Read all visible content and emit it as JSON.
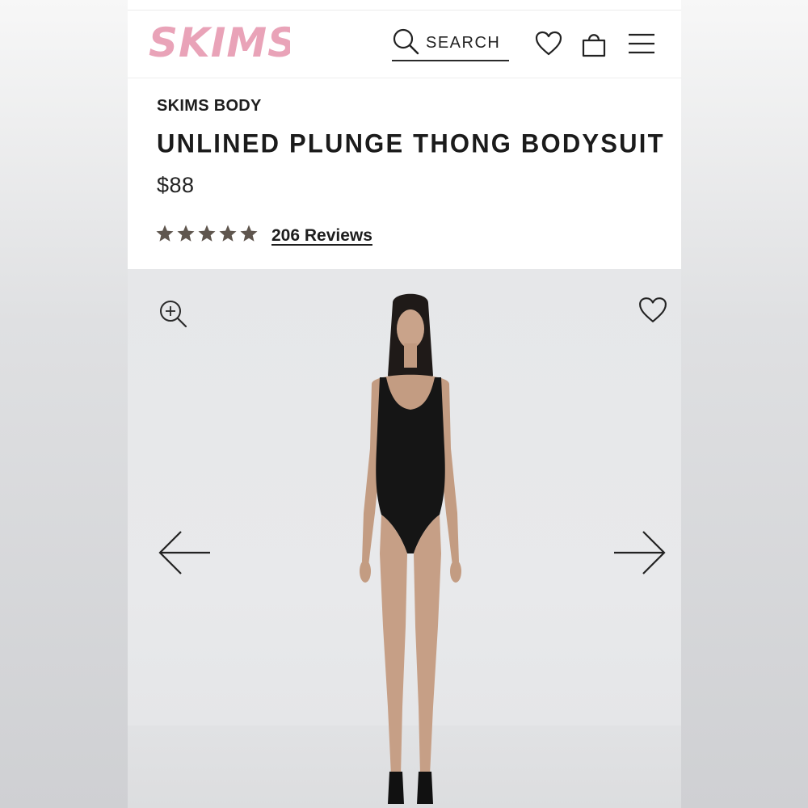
{
  "header": {
    "logo_text": "SKIMS",
    "search_label": "SEARCH"
  },
  "product": {
    "brand": "SKIMS BODY",
    "title": "UNLINED PLUNGE THONG BODYSUIT",
    "price": "$88",
    "rating": 4.8,
    "rating_max": 5,
    "reviews_label": "206 Reviews"
  },
  "icons": {
    "search": "search-icon",
    "wishlist": "heart-icon",
    "bag": "shopping-bag-icon",
    "menu": "hamburger-menu-icon",
    "zoom": "zoom-in-icon",
    "prev": "arrow-left-icon",
    "next": "arrow-right-icon"
  },
  "colors": {
    "logo": "#e9a3b8",
    "stars": "#5f564e",
    "text": "#1e1e1e"
  }
}
